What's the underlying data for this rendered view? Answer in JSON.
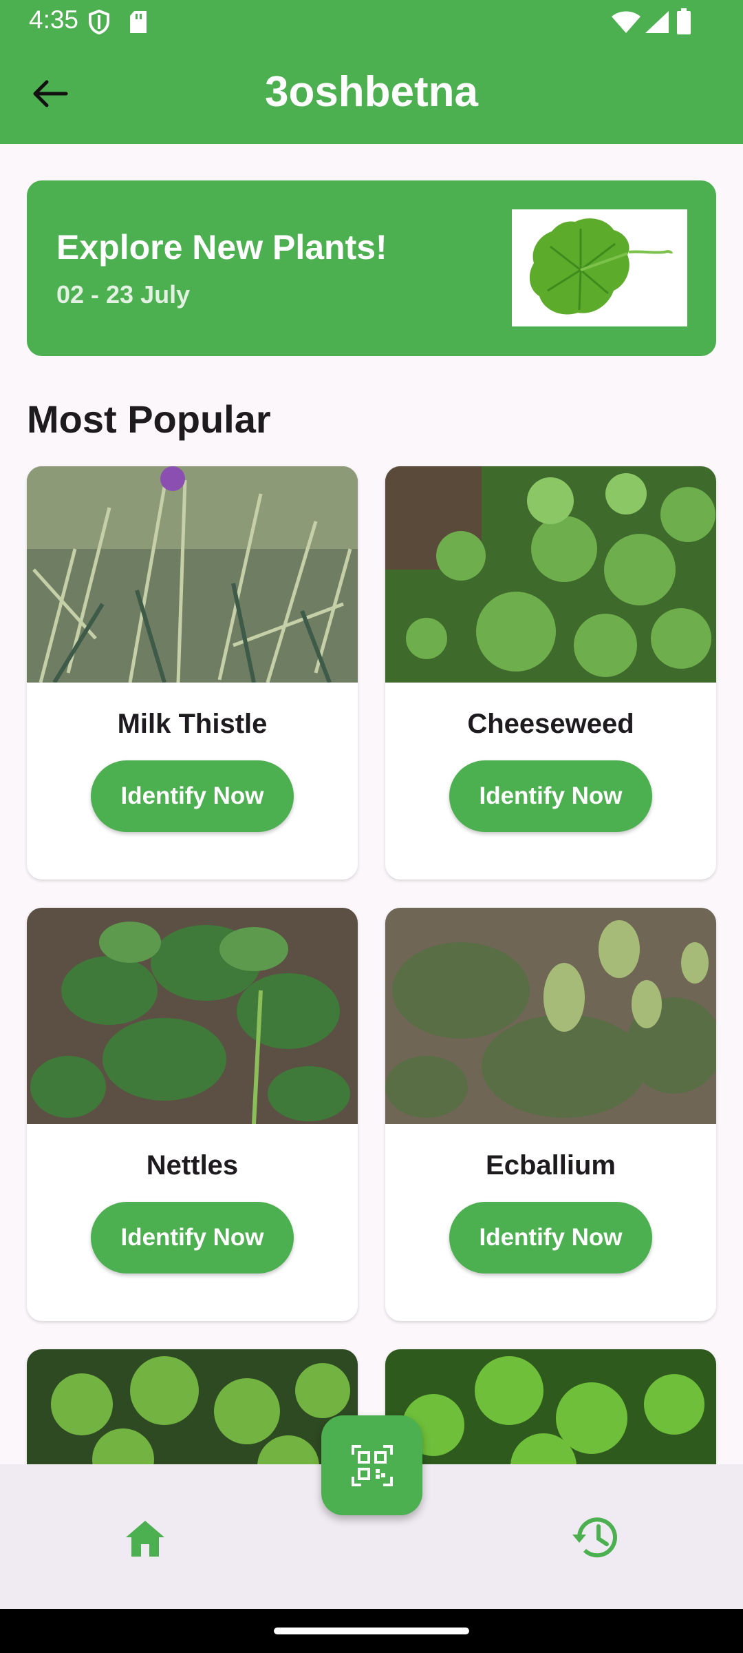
{
  "status_bar": {
    "time": "4:35",
    "left_icons": [
      "shield-icon",
      "sd-card-icon"
    ],
    "right_icons": [
      "wifi-icon",
      "signal-icon",
      "battery-icon"
    ]
  },
  "app_bar": {
    "title": "3oshbetna",
    "back_icon": "arrow-left-icon"
  },
  "banner": {
    "title": "Explore New Plants!",
    "date": "02 - 23 July",
    "image": "leaf-photo"
  },
  "section": {
    "title": "Most Popular"
  },
  "plants": [
    {
      "name": "Milk Thistle",
      "button": "Identify Now",
      "image": "milk-thistle-photo"
    },
    {
      "name": "Cheeseweed",
      "button": "Identify Now",
      "image": "cheeseweed-photo"
    },
    {
      "name": "Nettles",
      "button": "Identify Now",
      "image": "nettles-photo"
    },
    {
      "name": "Ecballium",
      "button": "Identify Now",
      "image": "ecballium-photo"
    },
    {
      "name": "",
      "button": "",
      "image": "parsley-photo"
    },
    {
      "name": "",
      "button": "",
      "image": "coriander-photo"
    }
  ],
  "bottom_nav": {
    "home_icon": "home-icon",
    "scan_icon": "qr-scan-icon",
    "history_icon": "history-icon"
  },
  "colors": {
    "primary": "#4caf50",
    "background": "#fbf7fb",
    "nav_background": "#f0ebf2",
    "text": "#1d1b1e"
  }
}
